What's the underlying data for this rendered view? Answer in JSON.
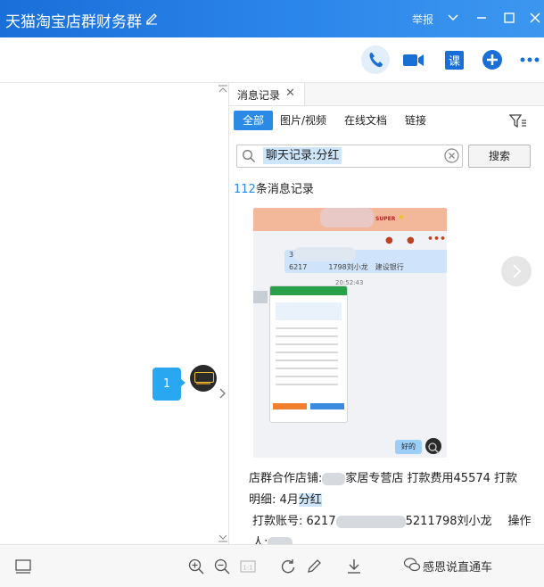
{
  "window": {
    "title": "天猫淘宝店群财务群",
    "report_label": "举报"
  },
  "chat": {
    "unread_bubble": "1"
  },
  "history": {
    "tab_label": "消息记录",
    "filters": [
      "全部",
      "图片/视频",
      "在线文档",
      "链接"
    ],
    "search": {
      "value": "聊天记录:分红",
      "button_label": "搜索"
    },
    "result_count": "112",
    "result_count_suffix": "条消息记录",
    "image_preview": {
      "banner_text": "SUPER",
      "message_text": "6217　　　1798刘小龙　建设银行",
      "message_prefix": "34",
      "timestamp": "20:52:43",
      "reply_text": "好的"
    },
    "message": {
      "line1_a": "店群合作店铺:",
      "line1_b": "家居专营店 打款费用45574 打款",
      "line2_a": "明细: 4月",
      "line2_hl": "分红",
      "line3_a": "打款账号: 6217",
      "line3_b": "5211798刘小龙",
      "line3_c": "操作",
      "line4_a": "人:"
    }
  },
  "footer": {
    "brand_text": "感恩说直通车"
  },
  "colors": {
    "titlebar": "#1b6fd8",
    "accent": "#2a8ae6",
    "bubble": "#29a7f0"
  }
}
